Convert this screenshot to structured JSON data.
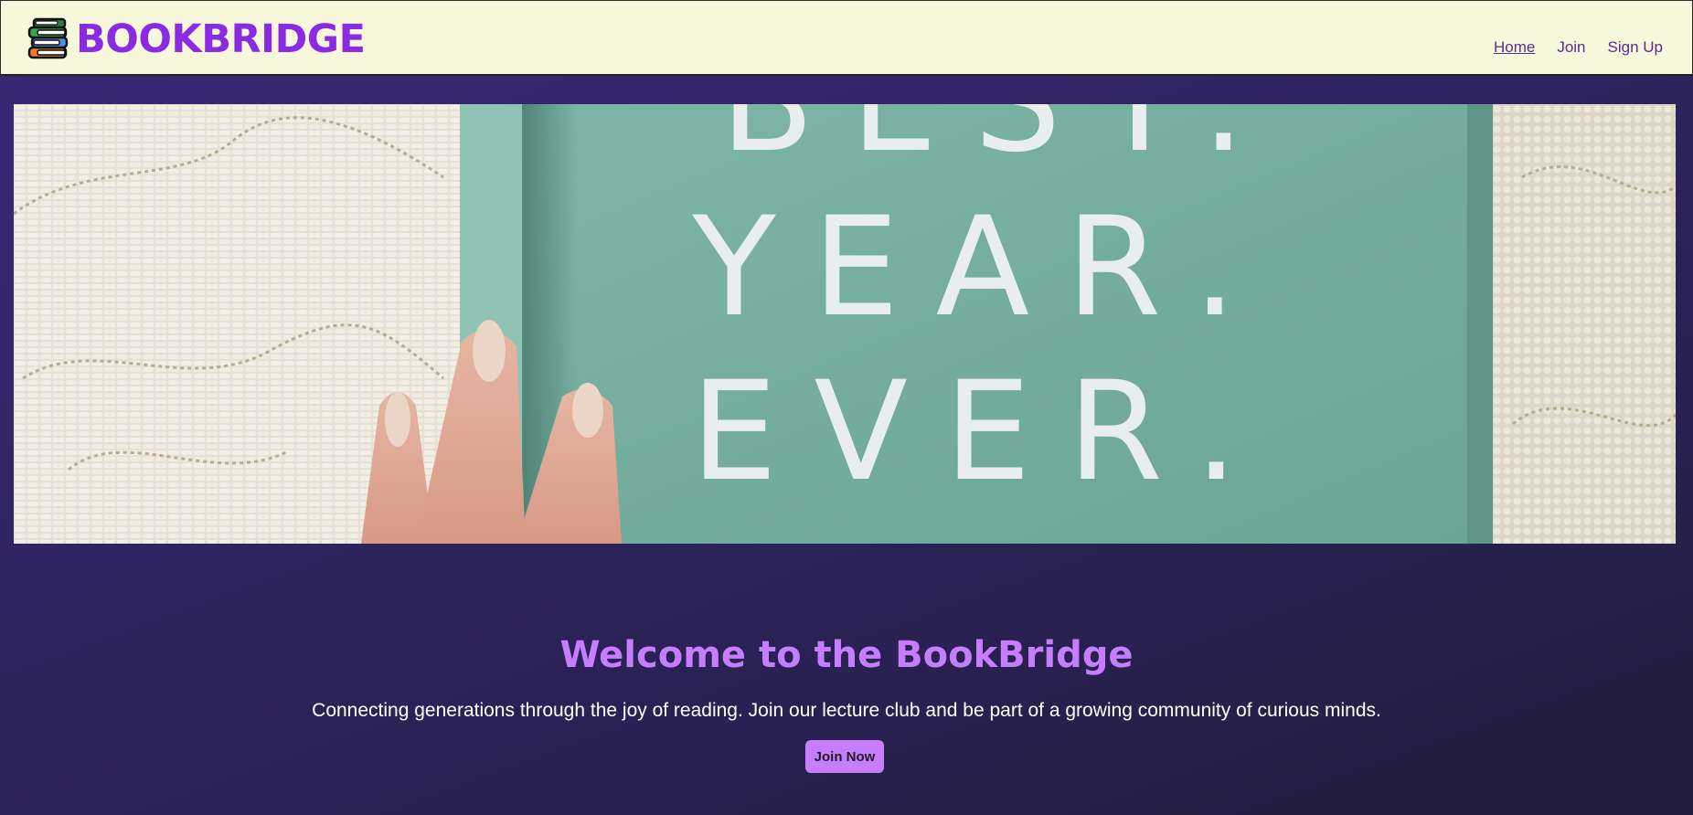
{
  "header": {
    "brand": "BOOKBRIDGE",
    "logo_icon": "book-stack-icon",
    "nav": [
      {
        "label": "Home",
        "active": true
      },
      {
        "label": "Join",
        "active": false
      },
      {
        "label": "Sign Up",
        "active": false
      }
    ]
  },
  "hero": {
    "image_text_lines": [
      "BEST.",
      "YEAR.",
      "EVER."
    ]
  },
  "welcome": {
    "title": "Welcome to the BookBridge",
    "tagline": "Connecting generations through the joy of reading. Join our lecture club and be part of a growing community of curious minds.",
    "button_label": "Join Now"
  },
  "colors": {
    "header_bg": "#f7f7dc",
    "brand": "#8a2be2",
    "nav_link": "#5a2d91",
    "page_bg": "#2e2460",
    "accent": "#c77dff"
  }
}
